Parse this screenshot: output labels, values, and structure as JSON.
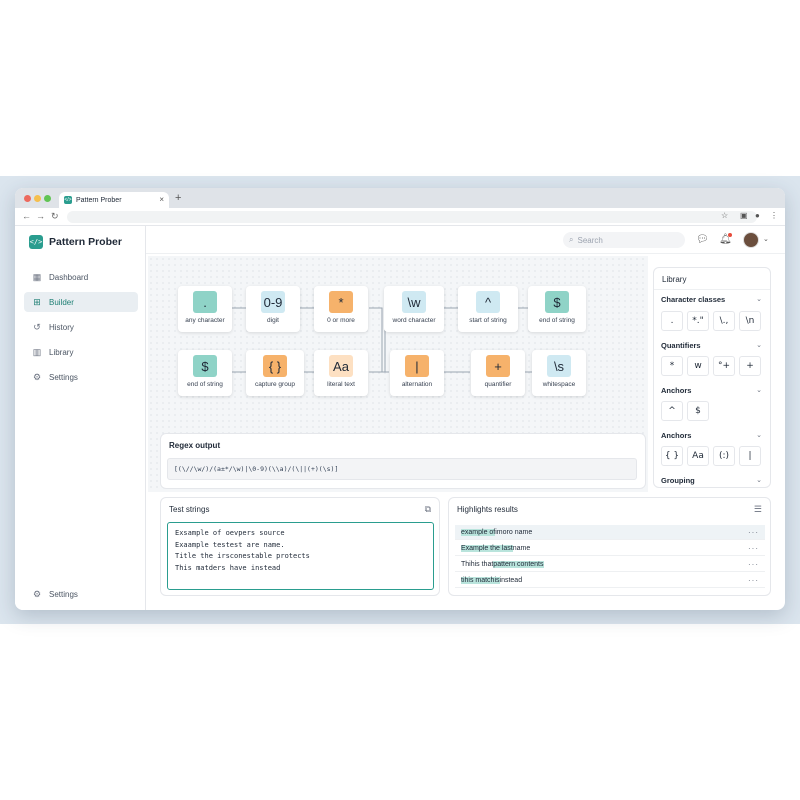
{
  "browser": {
    "tab_title": "Pattern Prober",
    "traffic_colors": [
      "#ed6a5e",
      "#f5bf4f",
      "#61c454"
    ]
  },
  "app": {
    "name": "Pattern Prober",
    "accent": "#2a9d8f"
  },
  "sidebar": {
    "items": [
      {
        "label": "Dashboard",
        "icon": "grid-icon"
      },
      {
        "label": "Builder",
        "icon": "nodes-icon",
        "active": true
      },
      {
        "label": "History",
        "icon": "history-icon"
      },
      {
        "label": "Library",
        "icon": "library-icon"
      },
      {
        "label": "Settings",
        "icon": "gear-icon"
      }
    ],
    "footer_label": "Settings"
  },
  "header": {
    "search_placeholder": "Search"
  },
  "builder": {
    "row1": [
      {
        "symbol": ".",
        "label": "any character",
        "color": "teal"
      },
      {
        "symbol": "0-9",
        "label": "digit",
        "color": "light"
      },
      {
        "symbol": "*",
        "label": "0 or more",
        "color": "orange"
      },
      {
        "symbol": "\\w",
        "label": "word character",
        "color": "light"
      },
      {
        "symbol": "^",
        "label": "start of string",
        "color": "light"
      },
      {
        "symbol": "$",
        "label": "end of string",
        "color": "teal"
      }
    ],
    "row2": [
      {
        "symbol": "$",
        "label": "end of string",
        "color": "teal"
      },
      {
        "symbol": "{ }",
        "label": "capture group",
        "color": "orange"
      },
      {
        "symbol": "Aa",
        "label": "literal text",
        "color": "peach"
      },
      {
        "symbol": "|",
        "label": "alternation",
        "color": "orange"
      },
      {
        "symbol": "+",
        "label": "quantifier",
        "color": "orange"
      },
      {
        "symbol": "\\s",
        "label": "whitespace",
        "color": "light"
      }
    ]
  },
  "regex_output": {
    "title": "Regex output",
    "value": "[(\\//\\w/)/(a±*/\\w)|\\0-9)(\\\\a)/(\\||(+)(\\s)]"
  },
  "library": {
    "title": "Library",
    "sections": [
      {
        "title": "Character classes",
        "chips": [
          ".",
          "*.\"",
          "\\.,",
          "\\n"
        ]
      },
      {
        "title": "Quantifiers",
        "chips": [
          "*",
          "w",
          "°+",
          "+"
        ]
      },
      {
        "title": "Anchors",
        "chips": [
          "^",
          "$"
        ]
      },
      {
        "title": "Anchors",
        "chips": [
          "{ }",
          "Aa",
          "(:)",
          "|"
        ]
      },
      {
        "title": "Grouping",
        "chips": []
      }
    ]
  },
  "test_strings": {
    "title": "Test strings",
    "lines": [
      "Exsample of oevpers source",
      "Exaample testest are name.",
      "Title the irsconestable protects",
      "This matders have instead"
    ]
  },
  "highlights": {
    "title": "Highlights results",
    "rows": [
      {
        "pre": "",
        "match": "example of",
        "post": " imoro name"
      },
      {
        "pre": "",
        "match": "Example the last",
        "post": " name"
      },
      {
        "pre": "Thihis that ",
        "match": "pattern contents",
        "post": ""
      },
      {
        "pre": "",
        "match": "tihis matchis",
        "post": " instead"
      }
    ]
  }
}
